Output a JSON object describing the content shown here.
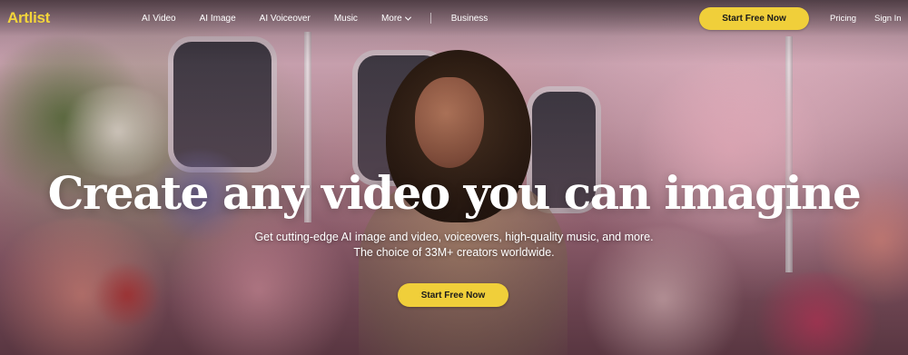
{
  "brand": {
    "logo_text": "Artlist",
    "accent": "#f0cf3a"
  },
  "nav": {
    "items": [
      {
        "label": "AI Video"
      },
      {
        "label": "AI Image"
      },
      {
        "label": "AI Voiceover"
      },
      {
        "label": "Music"
      },
      {
        "label": "More",
        "icon": "chevron-down-icon"
      }
    ],
    "business_label": "Business",
    "cta_label": "Start Free Now",
    "pricing_label": "Pricing",
    "signin_label": "Sign In"
  },
  "hero": {
    "headline": "Create any video you can imagine",
    "subtitle_line1": "Get cutting-edge AI image and video, voiceovers, high-quality music, and more.",
    "subtitle_line2": "The choice of 33M+ creators worldwide.",
    "cta_label": "Start Free Now"
  }
}
